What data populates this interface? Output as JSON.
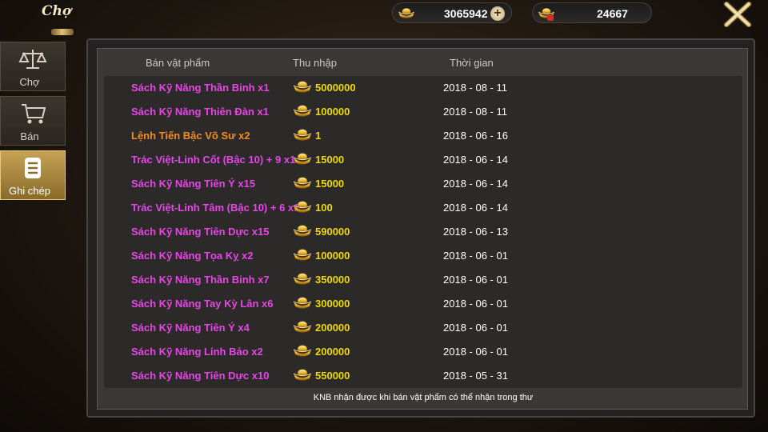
{
  "header": {
    "title": "Chợ",
    "gold_amount": "3065942",
    "bound_gold_amount": "24667",
    "plus_label": "+"
  },
  "sidebar": {
    "tabs": [
      {
        "label": "Chợ",
        "icon": "scales-icon"
      },
      {
        "label": "Bán",
        "icon": "cart-icon"
      },
      {
        "label": "Ghi chép",
        "icon": "notes-icon",
        "active": true
      }
    ]
  },
  "table": {
    "columns": [
      "Bán vật phẩm",
      "Thu nhập",
      "Thời gian"
    ],
    "rows": [
      {
        "name": "Sách Kỹ Năng Thần Binh x1",
        "income": "5000000",
        "date": "2018 - 08 - 11",
        "color": "#e646e6"
      },
      {
        "name": "Sách Kỹ Năng Thiên Đàn x1",
        "income": "100000",
        "date": "2018 - 08 - 11",
        "color": "#e646e6"
      },
      {
        "name": "Lệnh Tiến Bậc Võ Sư x2",
        "income": "1",
        "date": "2018 - 06 - 16",
        "color": "#f08c20"
      },
      {
        "name": "Trác Việt-Linh Cốt (Bậc 10) + 9 x1",
        "income": "15000",
        "date": "2018 - 06 - 14",
        "color": "#e646e6"
      },
      {
        "name": "Sách Kỹ Năng Tiên Ý x15",
        "income": "15000",
        "date": "2018 - 06 - 14",
        "color": "#e646e6"
      },
      {
        "name": "Trác Việt-Linh Tâm (Bậc 10) + 6 x1",
        "income": "100",
        "date": "2018 - 06 - 14",
        "color": "#e646e6"
      },
      {
        "name": "Sách Kỹ Năng Tiên Dực x15",
        "income": "590000",
        "date": "2018 - 06 - 13",
        "color": "#e646e6"
      },
      {
        "name": "Sách Kỹ Năng Tọa Kỵ x2",
        "income": "100000",
        "date": "2018 - 06 - 01",
        "color": "#e646e6"
      },
      {
        "name": "Sách Kỹ Năng Thần Binh x7",
        "income": "350000",
        "date": "2018 - 06 - 01",
        "color": "#e646e6"
      },
      {
        "name": "Sách Kỹ Năng Tay Kỳ Lân x6",
        "income": "300000",
        "date": "2018 - 06 - 01",
        "color": "#e646e6"
      },
      {
        "name": "Sách Kỹ Năng Tiên Ý x4",
        "income": "200000",
        "date": "2018 - 06 - 01",
        "color": "#e646e6"
      },
      {
        "name": "Sách Kỹ Năng Linh Bảo x2",
        "income": "200000",
        "date": "2018 - 06 - 01",
        "color": "#e646e6"
      },
      {
        "name": "Sách Kỹ Năng Tiên Dực x10",
        "income": "550000",
        "date": "2018 - 05 - 31",
        "color": "#e646e6"
      }
    ]
  },
  "footer": {
    "note": "KNB nhận được khi bán vật phẩm có thể nhận trong thư"
  },
  "colors": {
    "item_purple": "#e646e6",
    "item_orange": "#f08c20",
    "income_yellow": "#f0d800",
    "active_tab_gold": "#c6a254"
  }
}
